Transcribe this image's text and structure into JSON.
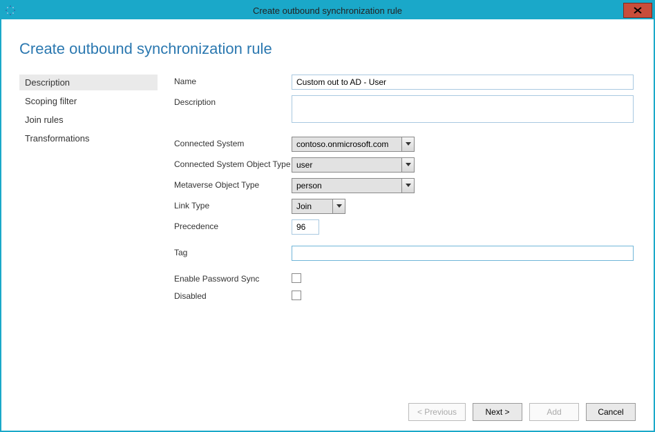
{
  "window": {
    "title": "Create outbound synchronization rule"
  },
  "page_title": "Create outbound synchronization rule",
  "sidebar": {
    "items": [
      {
        "label": "Description",
        "selected": true
      },
      {
        "label": "Scoping filter",
        "selected": false
      },
      {
        "label": "Join rules",
        "selected": false
      },
      {
        "label": "Transformations",
        "selected": false
      }
    ]
  },
  "form": {
    "name_label": "Name",
    "name_value": "Custom out to AD - User",
    "description_label": "Description",
    "description_value": "",
    "connected_system_label": "Connected System",
    "connected_system_value": "contoso.onmicrosoft.com",
    "cs_object_type_label": "Connected System Object Type",
    "cs_object_type_value": "user",
    "mv_object_type_label": "Metaverse Object Type",
    "mv_object_type_value": "person",
    "link_type_label": "Link Type",
    "link_type_value": "Join",
    "precedence_label": "Precedence",
    "precedence_value": "96",
    "tag_label": "Tag",
    "tag_value": "",
    "password_sync_label": "Enable Password Sync",
    "disabled_label": "Disabled"
  },
  "footer": {
    "previous": "< Previous",
    "next": "Next >",
    "add": "Add",
    "cancel": "Cancel"
  }
}
